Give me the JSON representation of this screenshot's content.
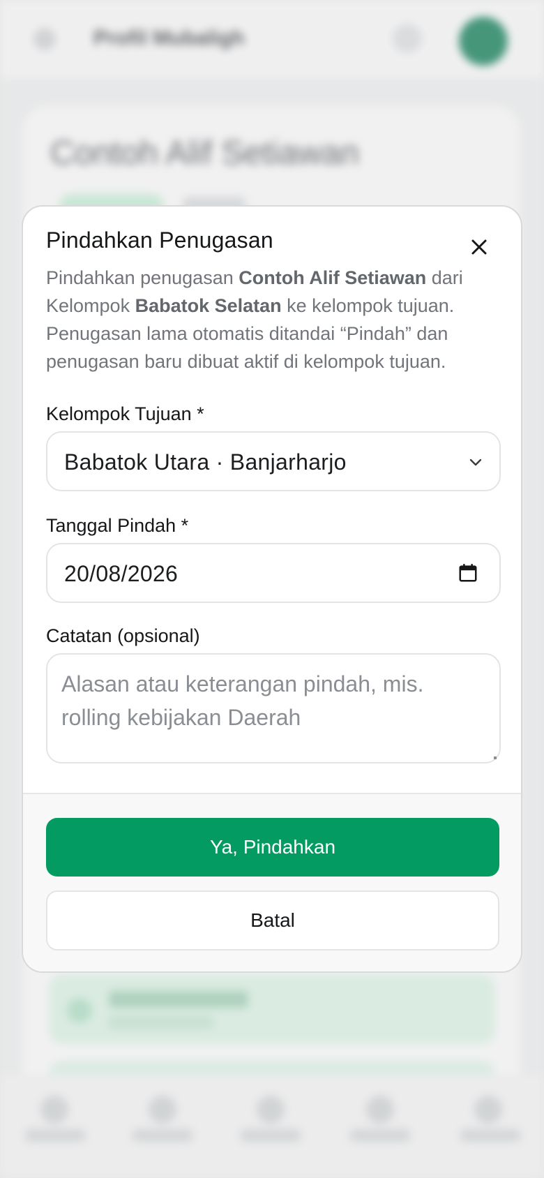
{
  "background": {
    "header_title": "Profil Mubaligh",
    "name": "Contoh Alif Setiawan"
  },
  "modal": {
    "title": "Pindahkan Penugasan",
    "desc": {
      "p1": "Pindahkan penugasan ",
      "person": "Contoh Alif Setiawan",
      "p2": " dari Kelompok ",
      "from_group": "Babatok Selatan",
      "p3": " ke kelompok tujuan. Penugasan lama otomatis ditandai “Pindah” dan penugasan baru dibuat aktif di kelompok tujuan."
    },
    "target_group": {
      "label": "Kelompok Tujuan *",
      "value": "Babatok Utara · Banjarharjo"
    },
    "move_date": {
      "label": "Tanggal Pindah *",
      "value": "20/08/2026"
    },
    "notes": {
      "label": "Catatan (opsional)",
      "placeholder": "Alasan atau keterangan pindah, mis. rolling kebijakan Daerah",
      "value": ""
    },
    "confirm_label": "Ya, Pindahkan",
    "cancel_label": "Batal"
  },
  "colors": {
    "primary": "#039b62",
    "avatar": "#0f7a55"
  },
  "icons": {
    "close": "close-icon",
    "chevron": "chevron-down-icon",
    "calendar": "calendar-icon"
  }
}
